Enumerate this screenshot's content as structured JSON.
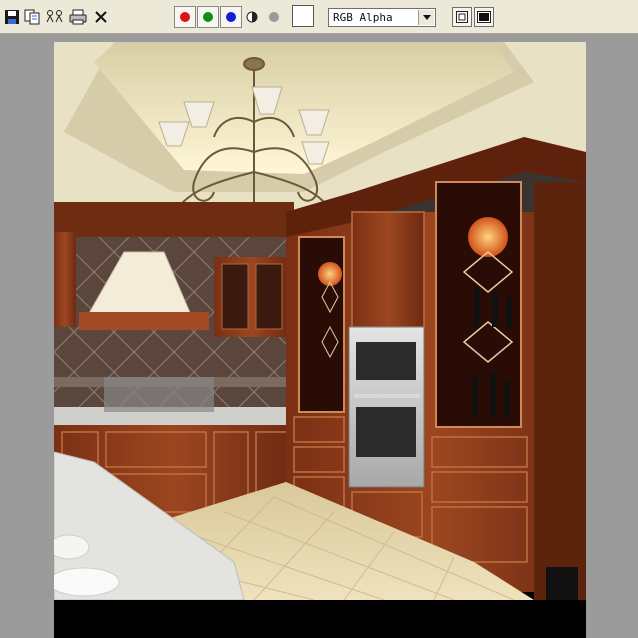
{
  "toolbar": {
    "buttons": [
      {
        "name": "save-icon"
      },
      {
        "name": "copy-icon"
      },
      {
        "name": "clone-window-icon"
      },
      {
        "name": "print-icon"
      },
      {
        "name": "close-icon"
      }
    ],
    "channels": [
      {
        "name": "red-channel-button",
        "color": "#e01010"
      },
      {
        "name": "green-channel-button",
        "color": "#109010"
      },
      {
        "name": "blue-channel-button",
        "color": "#1020d0"
      },
      {
        "name": "monochrome-button",
        "color": "#222222"
      },
      {
        "name": "alpha-channel-button",
        "color": "#9a9a9a"
      }
    ],
    "swatch_color": "#ffffff",
    "channel_select": {
      "value": "RGB Alpha"
    },
    "view_buttons": [
      {
        "name": "display-mode-icon"
      },
      {
        "name": "background-toggle-icon"
      }
    ]
  },
  "colors": {
    "toolbar_bg": "#ece9d8",
    "frame_bg": "#9b9b9b",
    "cabinet_wood": "#8a3b1b",
    "ceiling": "#efe7c6"
  }
}
